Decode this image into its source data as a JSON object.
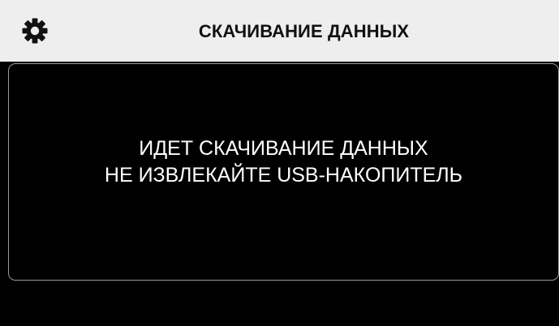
{
  "header": {
    "settings_icon": "gear-icon",
    "title": "СКАЧИВАНИЕ ДАННЫХ"
  },
  "message": {
    "line1": "ИДЕТ СКАЧИВАНИЕ ДАННЫХ",
    "line2": "НЕ ИЗВЛЕКАЙТЕ USB-НАКОПИТЕЛЬ"
  },
  "colors": {
    "header_bg": "#eeeeee",
    "screen_bg": "#000000",
    "panel_border": "#9a9a9a",
    "text_dark": "#111111",
    "text_light": "#ffffff"
  }
}
